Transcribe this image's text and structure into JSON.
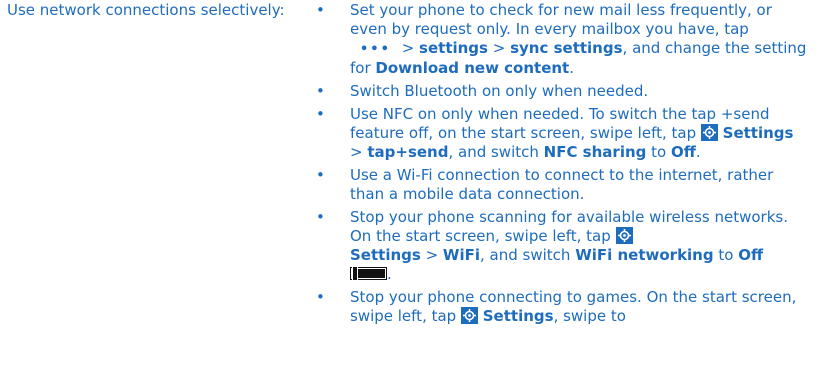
{
  "section": {
    "heading": "Use network connections selectively:"
  },
  "bullet_char": "•",
  "items": [
    {
      "t1": "Set your phone to check for new mail less frequently, or even by request only. In every mailbox you have, tap",
      "more": "•••",
      "t2": " > ",
      "b1": "settings",
      "t3": " > ",
      "b2": "sync settings",
      "t4": ", and change the setting for ",
      "b3": "Download new content",
      "t5": "."
    },
    {
      "t1": "Switch Bluetooth on only when needed."
    },
    {
      "t1": "Use NFC on only when needed. To switch the tap +send feature off, on the start screen, swipe left, tap ",
      "b1": "Settings",
      "t2": " > ",
      "b2": "tap+send",
      "t3": ", and switch ",
      "b3": "NFC sharing",
      "t4": " to ",
      "b4": "Off",
      "t5": "."
    },
    {
      "t1": "Use a Wi-Fi connection to connect to the internet, rather than a mobile data connection."
    },
    {
      "t1": "Stop your phone scanning for available wireless networks. On the start screen, swipe left, tap ",
      "b1": "Settings",
      "t2": " > ",
      "b2": "WiFi",
      "t3": ", and switch ",
      "b3": "WiFi networking",
      "t4": " to ",
      "b4": "Off",
      "t5": "."
    },
    {
      "t1": "Stop your phone connecting to games. On the start screen, swipe left, tap ",
      "b1": "Settings",
      "t2": ", swipe to"
    }
  ],
  "icons": {
    "more": "more-dots-icon",
    "settings": "settings-gear-icon",
    "toggle": "toggle-off-icon"
  },
  "colors": {
    "text": "#1e6cbd",
    "icon_bg": "#1e6cbd",
    "toggle": "#111111"
  }
}
